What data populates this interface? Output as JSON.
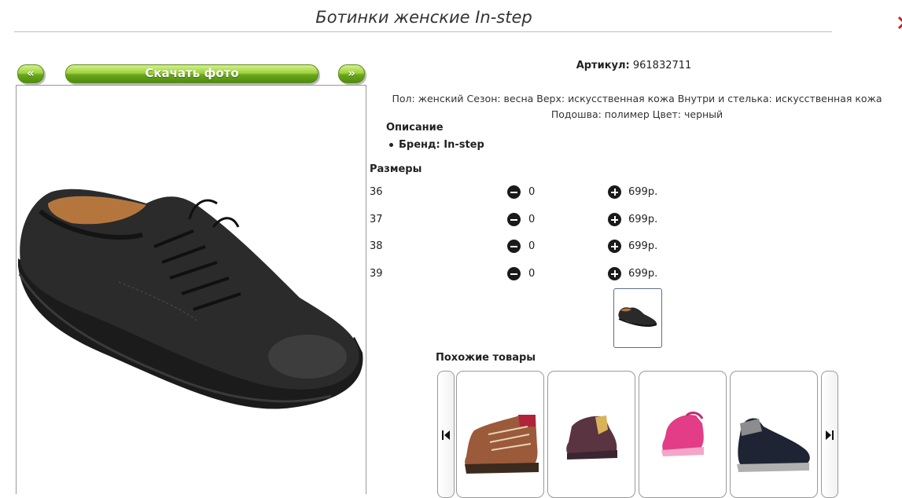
{
  "product": {
    "title": "Ботинки женские In-step",
    "article_label": "Артикул:",
    "article_value": "961832711",
    "description": "Пол: женский Сезон: весна Верх: искусственная кожа Внутри и стелька: искусственная кожа Подошва: полимер Цвет: черный",
    "description_heading": "Описание",
    "brand_line": "Бренд: In-step"
  },
  "gallery": {
    "prev_label": "«",
    "download_label": "Скачать фото",
    "next_label": "»"
  },
  "sizes": {
    "heading": "Размеры",
    "rows": [
      {
        "size": "36",
        "qty": "0",
        "price": "699р."
      },
      {
        "size": "37",
        "qty": "0",
        "price": "699р."
      },
      {
        "size": "38",
        "qty": "0",
        "price": "699р."
      },
      {
        "size": "39",
        "qty": "0",
        "price": "699р."
      }
    ]
  },
  "similar": {
    "heading": "Похожие товары",
    "items": [
      "brown-hiking-boot",
      "purple-kids-boot",
      "pink-sneaker-boot",
      "black-winter-boot"
    ]
  },
  "icons": [
    "minus-circle-icon",
    "plus-circle-icon",
    "skip-back-icon",
    "skip-forward-icon"
  ],
  "colors": {
    "button_green": "#6aa81c",
    "text": "#222222"
  }
}
